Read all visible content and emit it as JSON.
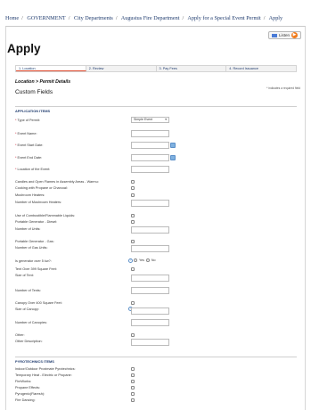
{
  "breadcrumb": [
    "Home",
    "GOVERNMENT",
    "City Departments",
    "Augustus Fire Department",
    "Apply for a Special Event Permit",
    "Apply"
  ],
  "lang_button": {
    "label": "Listen"
  },
  "page_title": "Apply",
  "steps": [
    "1. Location",
    "2. Review",
    "3. Pay Fees",
    "4. Record Issuance"
  ],
  "subtitle": "Location > Permit Details",
  "required_note": "* indicates a required field",
  "custom_fields_title": "Custom Fields",
  "application_section": {
    "title": "APPLICATION ITEMS",
    "type_of_permit": {
      "label": "Type of Permit:",
      "value": "Simple Event"
    },
    "event_name": {
      "label": "Event Name:"
    },
    "event_start_date": {
      "label": "Event Start Date:"
    },
    "event_end_date": {
      "label": "Event End Date:"
    },
    "location_of_event": {
      "label": "Location of the Event:"
    },
    "candles": {
      "label": "Candles and Open Flames in Assembly Areas - Warmu:"
    },
    "cooking_propane": {
      "label": "Cooking with Propane or Charcoal:"
    },
    "mushroom_heaters": {
      "label": "Mushroom Heaters:"
    },
    "num_mushroom_heaters": {
      "label": "Number of Mushroom Heaters:"
    },
    "combustible_liquids": {
      "label": "Use of Combustible/Flammable Liquids:"
    },
    "portable_gen_diesel": {
      "label": "Portable Generator - Diesel:"
    },
    "num_units_diesel": {
      "label": "Number of Units:"
    },
    "portable_gen_gas": {
      "label": "Portable Generator - Gas:"
    },
    "num_gas_units": {
      "label": "Number of Gas Units:"
    },
    "generator_over": {
      "label": "Is generator over 5 kw?:",
      "yes": "Yes",
      "no": "No"
    },
    "tent_over": {
      "label": "Tent Over 399 Square Feet:"
    },
    "size_of_tent": {
      "label": "Size of Tent:"
    },
    "num_tents": {
      "label": "Number of Tents:"
    },
    "canopy_over": {
      "label": "Canopy Over 400 Square Feet:"
    },
    "size_of_canopy": {
      "label": "Size of Canopy:"
    },
    "num_canopies": {
      "label": "Number of Canopies:"
    },
    "other": {
      "label": "Other:"
    },
    "other_description": {
      "label": "Other Description:"
    }
  },
  "pyrotechnics_section": {
    "title": "PYROTECHNICS ITEMS",
    "items": [
      "Indoor/Outdoor Proximate Pyrotechnics:",
      "Temporary Heat - Electric or Propane:",
      "FireWorks:",
      "Propane Effects:",
      "Pyrogenic(Flaresh):",
      "Fire Dancing:"
    ]
  }
}
